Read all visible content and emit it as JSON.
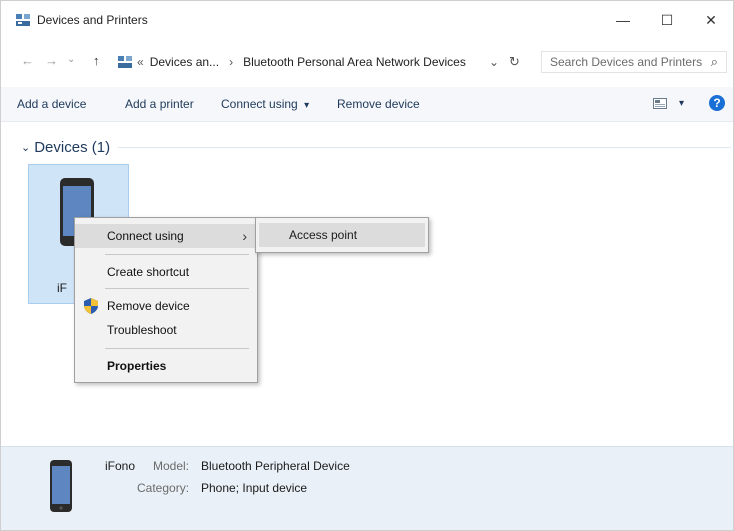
{
  "window": {
    "title": "Devices and Printers",
    "minimize": "—",
    "maximize": "☐",
    "close": "✕"
  },
  "address": {
    "back": "←",
    "forward": "→",
    "recent": "⌄",
    "up": "↑",
    "breadcrumb_prefix": "«",
    "crumb1": "Devices an...",
    "sep": "›",
    "crumb2": "Bluetooth Personal Area Network Devices",
    "dropdown": "⌄",
    "refresh": "↻",
    "search_placeholder": "Search Devices and Printers",
    "search_icon": "⌕"
  },
  "toolbar": {
    "add_device": "Add a device",
    "add_printer": "Add a printer",
    "connect_using": "Connect using",
    "connect_caret": "▾",
    "remove_device": "Remove device",
    "view_caret": "▾",
    "help": "?"
  },
  "group": {
    "chevron": "⌄",
    "label": "Devices (1)"
  },
  "device": {
    "label_visible": "iF"
  },
  "context_menu": {
    "connect_using": "Connect using",
    "arrow": "›",
    "create_shortcut": "Create shortcut",
    "remove_device": "Remove device",
    "troubleshoot": "Troubleshoot",
    "properties": "Properties"
  },
  "submenu": {
    "access_point": "Access point"
  },
  "details": {
    "name": "iFono",
    "model_label": "Model:",
    "model_value": "Bluetooth Peripheral Device",
    "category_label": "Category:",
    "category_value": "Phone; Input device"
  },
  "colors": {
    "accent": "#1e395b",
    "selection": "#cfe4f7",
    "help": "#1a6fd6"
  }
}
